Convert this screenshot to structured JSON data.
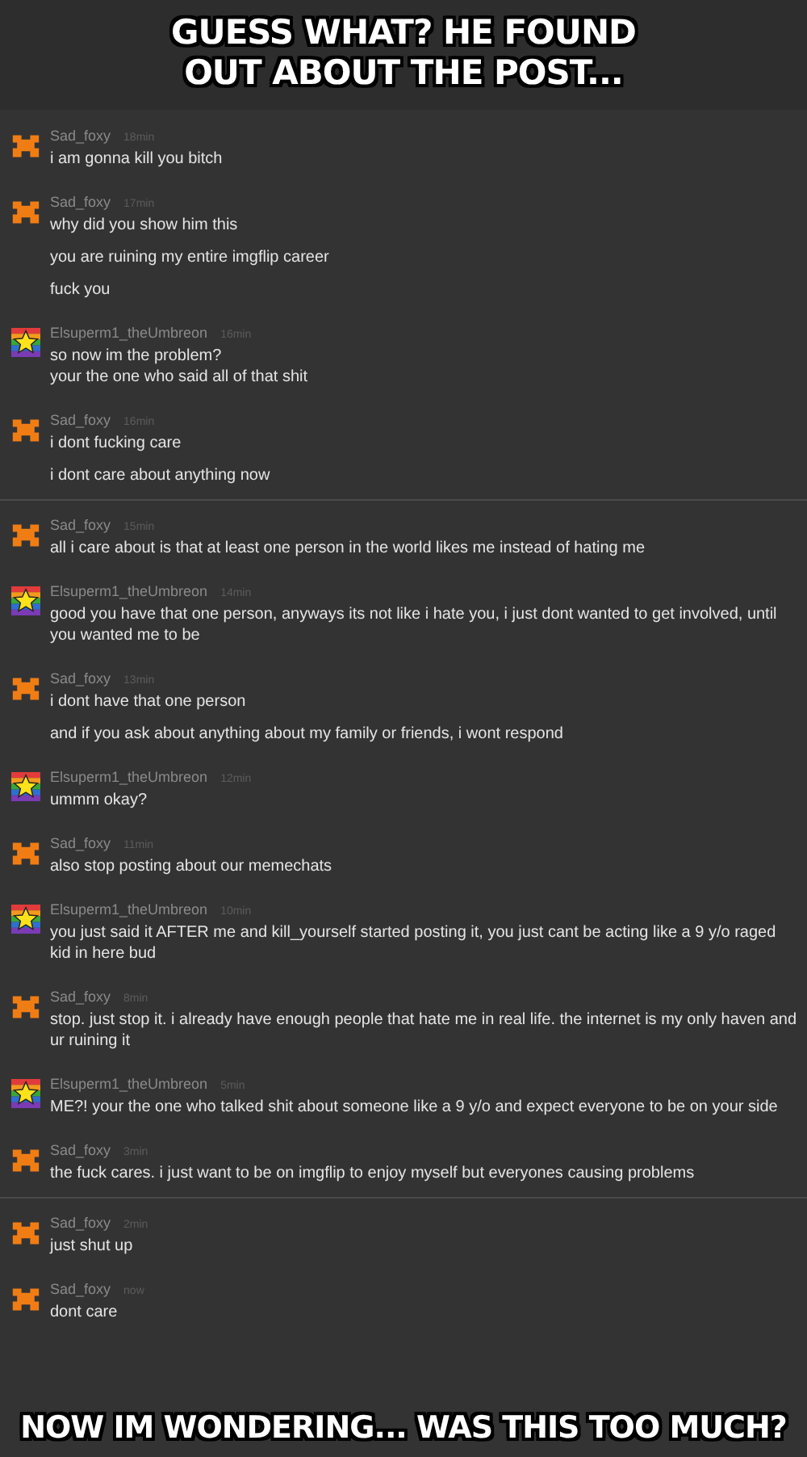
{
  "top_caption": "GUESS WHAT? HE FOUND OUT ABOUT THE POST...",
  "chat": [
    {
      "kind": "fox",
      "name": "Sad_foxy",
      "time": "18min",
      "messages": [
        "i am gonna kill you bitch"
      ],
      "divider_after": false
    },
    {
      "kind": "fox",
      "name": "Sad_foxy",
      "time": "17min",
      "messages": [
        "why did you show him this",
        "you are ruining my entire imgflip career",
        "fuck you"
      ],
      "divider_after": false
    },
    {
      "kind": "star",
      "name": "Elsuperm1_theUmbreon",
      "time": "16min",
      "messages": [
        "so now im the problem?\nyour the one who said all of that shit"
      ],
      "divider_after": false
    },
    {
      "kind": "fox",
      "name": "Sad_foxy",
      "time": "16min",
      "messages": [
        "i dont fucking care",
        "i dont care about anything now"
      ],
      "divider_after": true
    },
    {
      "kind": "fox",
      "name": "Sad_foxy",
      "time": "15min",
      "messages": [
        "all i care about is that at least one person in the world likes me instead of hating me"
      ],
      "divider_after": false
    },
    {
      "kind": "star",
      "name": "Elsuperm1_theUmbreon",
      "time": "14min",
      "messages": [
        "good you have that one person, anyways its not like i hate you, i just dont wanted to get involved, until you wanted me to be"
      ],
      "divider_after": false
    },
    {
      "kind": "fox",
      "name": "Sad_foxy",
      "time": "13min",
      "messages": [
        "i dont have that one person",
        "and if you ask about anything about my family or friends, i wont respond"
      ],
      "divider_after": false
    },
    {
      "kind": "star",
      "name": "Elsuperm1_theUmbreon",
      "time": "12min",
      "messages": [
        "ummm okay?"
      ],
      "divider_after": false
    },
    {
      "kind": "fox",
      "name": "Sad_foxy",
      "time": "11min",
      "messages": [
        "also stop posting about our memechats"
      ],
      "divider_after": false
    },
    {
      "kind": "star",
      "name": "Elsuperm1_theUmbreon",
      "time": "10min",
      "messages": [
        "you just said it AFTER me and kill_yourself started posting it, you just cant be acting like a 9 y/o raged kid in here bud"
      ],
      "divider_after": false
    },
    {
      "kind": "fox",
      "name": "Sad_foxy",
      "time": "8min",
      "messages": [
        "stop. just stop it. i already have enough people that hate me in real life. the internet is my only haven and ur ruining it"
      ],
      "divider_after": false
    },
    {
      "kind": "star",
      "name": "Elsuperm1_theUmbreon",
      "time": "5min",
      "messages": [
        "ME?! your the one who talked shit about someone like a 9 y/o and expect everyone to be on your side"
      ],
      "divider_after": false
    },
    {
      "kind": "fox",
      "name": "Sad_foxy",
      "time": "3min",
      "messages": [
        "the fuck cares. i just want to be on imgflip to enjoy myself but everyones causing problems"
      ],
      "divider_after": true
    },
    {
      "kind": "fox",
      "name": "Sad_foxy",
      "time": "2min",
      "messages": [
        "just shut up"
      ],
      "divider_after": false
    },
    {
      "kind": "fox",
      "name": "Sad_foxy",
      "time": "now",
      "messages": [
        "dont care"
      ],
      "divider_after": false
    }
  ],
  "bottom_caption": "NOW IM WONDERING... WAS THIS TOO MUCH?"
}
